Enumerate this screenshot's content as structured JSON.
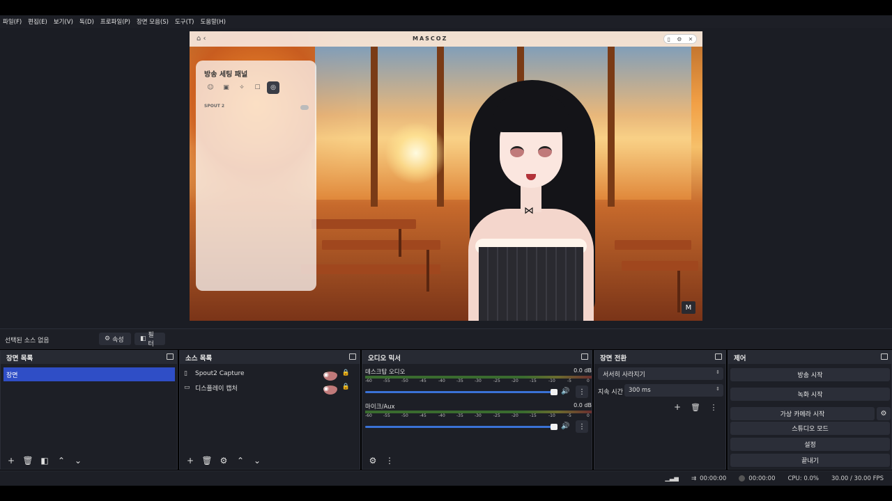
{
  "menu": [
    "파일(F)",
    "편집(E)",
    "보기(V)",
    "독(D)",
    "프로파일(P)",
    "장면 모음(S)",
    "도구(T)",
    "도움말(H)"
  ],
  "preview": {
    "logo_text": "MASCOZ",
    "panel_title": "방송 세팅 패널",
    "spout_label": "SPOUT 2"
  },
  "source_bar": {
    "no_source": "선택된 소스 없음",
    "properties": "속성",
    "filters": "필터"
  },
  "docks": {
    "scenes": {
      "title": "장면 목록",
      "items": [
        "장면"
      ]
    },
    "sources": {
      "title": "소스 목록",
      "items": [
        "Spout2 Capture",
        "디스플레이 캡처"
      ]
    },
    "mixer": {
      "title": "오디오 믹서",
      "channels": [
        {
          "name": "데스크탑 오디오",
          "db": "0.0 dB"
        },
        {
          "name": "마이크/Aux",
          "db": "0.0 dB"
        }
      ],
      "ticks": [
        "-60",
        "-55",
        "-50",
        "-45",
        "-40",
        "-35",
        "-30",
        "-25",
        "-20",
        "-15",
        "-10",
        "-5",
        "0"
      ]
    },
    "transitions": {
      "title": "장면 전환",
      "selected": "서서히 사라지기",
      "duration_label": "지속 시간",
      "duration_value": "300 ms"
    },
    "controls": {
      "title": "제어",
      "start_stream": "방송 시작",
      "start_recording": "녹화 시작",
      "start_virtualcam": "가상 카메라 시작",
      "studio_mode": "스튜디오 모드",
      "settings": "설정",
      "exit": "끝내기"
    }
  },
  "status": {
    "stream_time": "00:00:00",
    "rec_time": "00:00:00",
    "cpu": "CPU: 0.0%",
    "fps": "30.00 / 30.00 FPS"
  }
}
